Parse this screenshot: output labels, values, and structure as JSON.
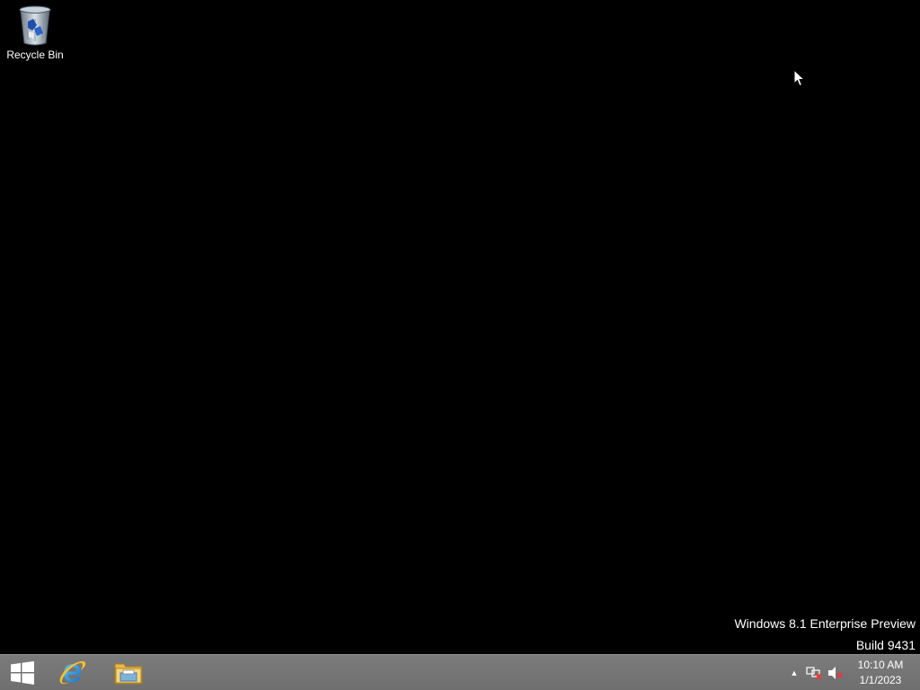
{
  "desktop": {
    "icons": [
      {
        "label": "Recycle Bin",
        "icon": "recycle-bin-icon"
      }
    ],
    "watermark": {
      "line1": "Windows 8.1 Enterprise Preview",
      "line2": "Build 9431"
    },
    "background_color": "#000000"
  },
  "taskbar": {
    "background_color": "#747474",
    "pinned": [
      {
        "name": "start",
        "icon": "windows-logo-icon"
      },
      {
        "name": "internet-explorer",
        "icon": "internet-explorer-icon"
      },
      {
        "name": "file-explorer",
        "icon": "file-explorer-icon"
      }
    ],
    "tray": {
      "show_hidden_icon": "chevron-up-icon",
      "network_icon": "network-disconnected-icon",
      "volume_icon": "volume-muted-icon",
      "time": "10:10 AM",
      "date": "1/1/2023"
    }
  }
}
